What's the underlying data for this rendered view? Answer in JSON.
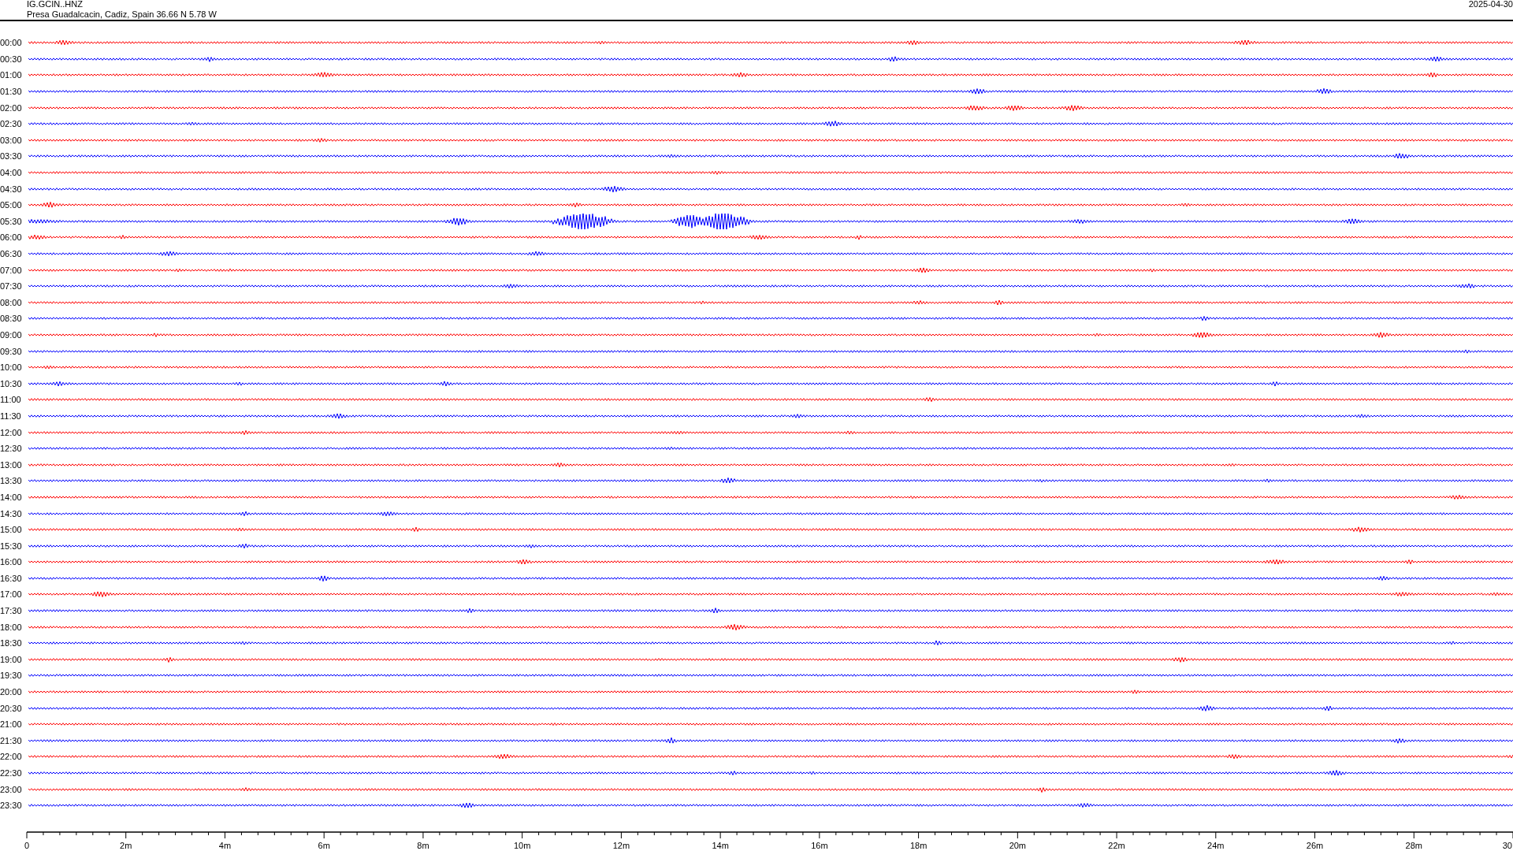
{
  "header": {
    "station": "IG.GCIN..HNZ",
    "location": "Presa Guadalcacin, Cadiz, Spain  36.66 N 5.78 W",
    "date": "2025-04-30"
  },
  "traces": [
    {
      "label": "00:00",
      "color": "#ff0000"
    },
    {
      "label": "00:30",
      "color": "#0000ff"
    },
    {
      "label": "01:00",
      "color": "#ff0000"
    },
    {
      "label": "01:30",
      "color": "#0000ff"
    },
    {
      "label": "02:00",
      "color": "#ff0000"
    },
    {
      "label": "02:30",
      "color": "#0000ff"
    },
    {
      "label": "03:00",
      "color": "#ff0000"
    },
    {
      "label": "03:30",
      "color": "#0000ff"
    },
    {
      "label": "04:00",
      "color": "#ff0000"
    },
    {
      "label": "04:30",
      "color": "#0000ff"
    },
    {
      "label": "05:00",
      "color": "#ff0000"
    },
    {
      "label": "05:30",
      "color": "#0000ff"
    },
    {
      "label": "06:00",
      "color": "#ff0000"
    },
    {
      "label": "06:30",
      "color": "#0000ff"
    },
    {
      "label": "07:00",
      "color": "#ff0000"
    },
    {
      "label": "07:30",
      "color": "#0000ff"
    },
    {
      "label": "08:00",
      "color": "#ff0000"
    },
    {
      "label": "08:30",
      "color": "#0000ff"
    },
    {
      "label": "09:00",
      "color": "#ff0000"
    },
    {
      "label": "09:30",
      "color": "#0000ff"
    },
    {
      "label": "10:00",
      "color": "#ff0000"
    },
    {
      "label": "10:30",
      "color": "#0000ff"
    },
    {
      "label": "11:00",
      "color": "#ff0000"
    },
    {
      "label": "11:30",
      "color": "#0000ff"
    },
    {
      "label": "12:00",
      "color": "#ff0000"
    },
    {
      "label": "12:30",
      "color": "#0000ff"
    },
    {
      "label": "13:00",
      "color": "#ff0000"
    },
    {
      "label": "13:30",
      "color": "#0000ff"
    },
    {
      "label": "14:00",
      "color": "#ff0000"
    },
    {
      "label": "14:30",
      "color": "#0000ff"
    },
    {
      "label": "15:00",
      "color": "#ff0000"
    },
    {
      "label": "15:30",
      "color": "#0000ff"
    },
    {
      "label": "16:00",
      "color": "#ff0000"
    },
    {
      "label": "16:30",
      "color": "#0000ff"
    },
    {
      "label": "17:00",
      "color": "#ff0000"
    },
    {
      "label": "17:30",
      "color": "#0000ff"
    },
    {
      "label": "18:00",
      "color": "#ff0000"
    },
    {
      "label": "18:30",
      "color": "#0000ff"
    },
    {
      "label": "19:00",
      "color": "#ff0000"
    },
    {
      "label": "19:30",
      "color": "#0000ff"
    },
    {
      "label": "20:00",
      "color": "#ff0000"
    },
    {
      "label": "20:30",
      "color": "#0000ff"
    },
    {
      "label": "21:00",
      "color": "#ff0000"
    },
    {
      "label": "21:30",
      "color": "#0000ff"
    },
    {
      "label": "22:00",
      "color": "#ff0000"
    },
    {
      "label": "22:30",
      "color": "#0000ff"
    },
    {
      "label": "23:00",
      "color": "#ff0000"
    },
    {
      "label": "23:30",
      "color": "#0000ff"
    }
  ],
  "axis": {
    "ticks": [
      "0",
      "2m",
      "4m",
      "6m",
      "8m",
      "10m",
      "12m",
      "14m",
      "16m",
      "18m",
      "20m",
      "22m",
      "24m",
      "26m",
      "28m",
      "30"
    ]
  }
}
